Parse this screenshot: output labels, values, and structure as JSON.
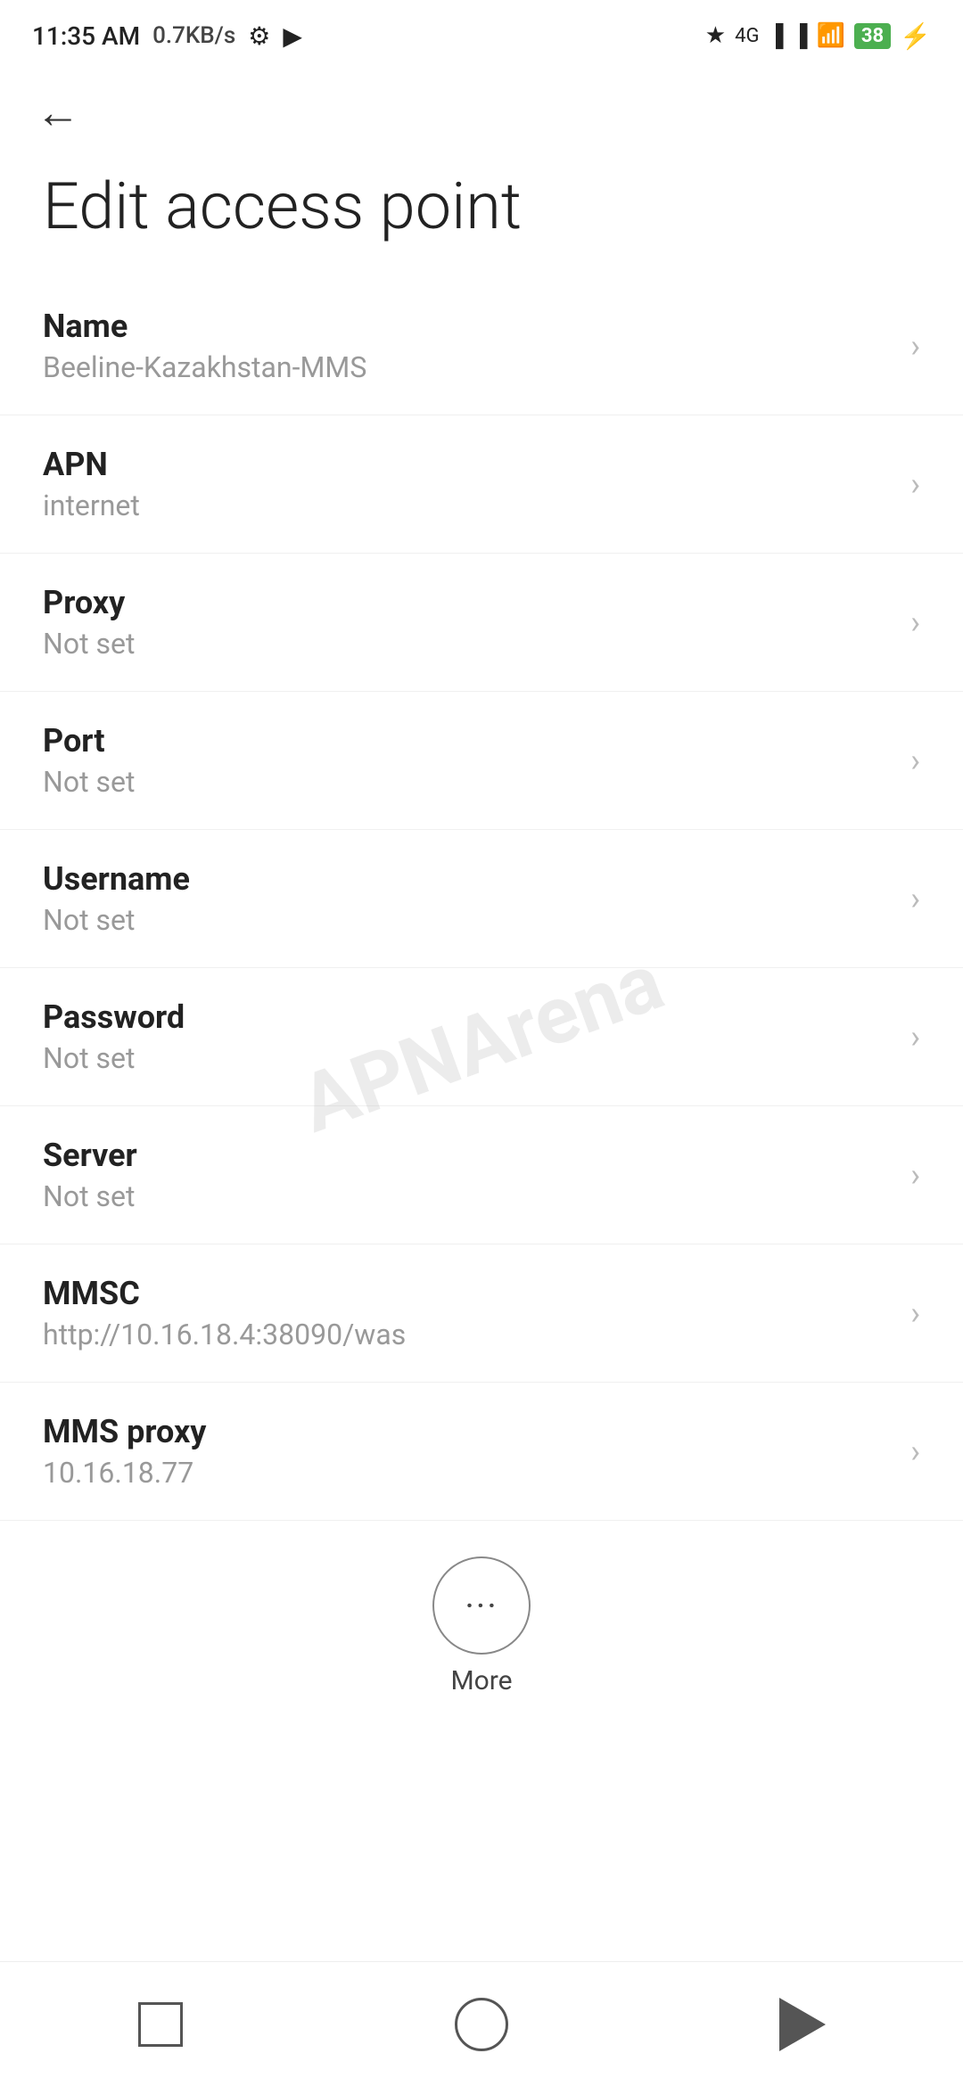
{
  "statusBar": {
    "time": "11:35 AM",
    "speed": "0.7KB/s",
    "batteryPercent": "38"
  },
  "toolbar": {
    "backLabel": "←"
  },
  "page": {
    "title": "Edit access point"
  },
  "settings": [
    {
      "label": "Name",
      "value": "Beeline-Kazakhstan-MMS"
    },
    {
      "label": "APN",
      "value": "internet"
    },
    {
      "label": "Proxy",
      "value": "Not set"
    },
    {
      "label": "Port",
      "value": "Not set"
    },
    {
      "label": "Username",
      "value": "Not set"
    },
    {
      "label": "Password",
      "value": "Not set"
    },
    {
      "label": "Server",
      "value": "Not set"
    },
    {
      "label": "MMSC",
      "value": "http://10.16.18.4:38090/was"
    },
    {
      "label": "MMS proxy",
      "value": "10.16.18.77"
    }
  ],
  "more": {
    "label": "More",
    "dots": "···"
  },
  "watermark": {
    "text": "APNArena"
  },
  "navbar": {
    "home": "",
    "back": "",
    "recents": ""
  }
}
